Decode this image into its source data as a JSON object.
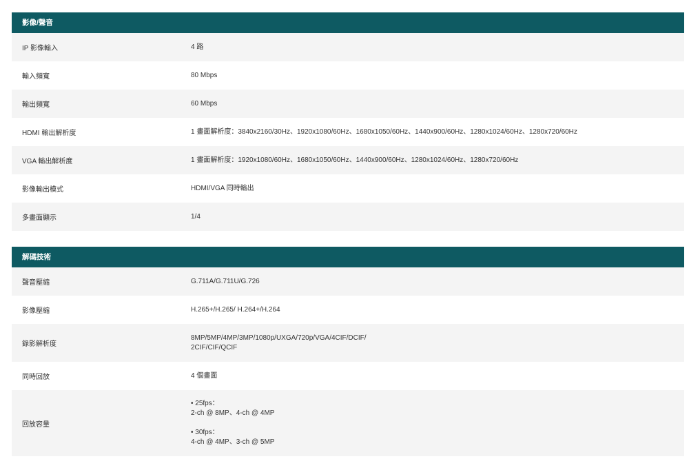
{
  "sections": [
    {
      "title": "影像/聲音",
      "rows": [
        {
          "label": "IP 影像輸入",
          "value": [
            "4 路"
          ]
        },
        {
          "label": "輸入頻寬",
          "value": [
            "80 Mbps"
          ]
        },
        {
          "label": "輸出頻寬",
          "value": [
            "60 Mbps"
          ]
        },
        {
          "label": "HDMI 輸出解析度",
          "value": [
            "1 畫面解析度：3840x2160/30Hz、1920x1080/60Hz、1680x1050/60Hz、1440x900/60Hz、1280x1024/60Hz、1280x720/60Hz"
          ]
        },
        {
          "label": "VGA 輸出解析度",
          "value": [
            "1 畫面解析度：1920x1080/60Hz、1680x1050/60Hz、1440x900/60Hz、1280x1024/60Hz、1280x720/60Hz"
          ]
        },
        {
          "label": "影像輸出模式",
          "value": [
            "HDMI/VGA 同時輸出"
          ]
        },
        {
          "label": "多畫面顯示",
          "value": [
            "1/4"
          ]
        }
      ]
    },
    {
      "title": "解碼技術",
      "rows": [
        {
          "label": "聲音壓縮",
          "value": [
            "G.711A/G.711U/G.726"
          ]
        },
        {
          "label": "影像壓縮",
          "value": [
            "H.265+/H.265/ H.264+/H.264"
          ]
        },
        {
          "label": "錄影解析度",
          "value": [
            "8MP/5MP/4MP/3MP/1080p/UXGA/720p/VGA/4CIF/DCIF/",
            "2CIF/CIF/QCIF"
          ]
        },
        {
          "label": "同時回放",
          "value": [
            "4 個畫面"
          ]
        },
        {
          "label": "回放容量",
          "value": [
            "• 25fps：",
            "2-ch @ 8MP、4-ch @ 4MP",
            "",
            "• 30fps：",
            "4-ch @ 4MP、3-ch @ 5MP"
          ]
        }
      ]
    }
  ]
}
